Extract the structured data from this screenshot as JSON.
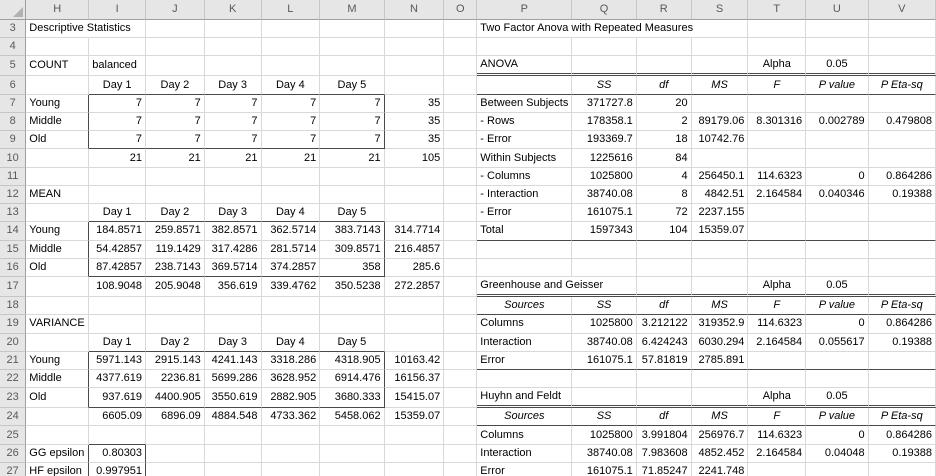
{
  "sheet": {
    "column_headers": [
      "H",
      "I",
      "J",
      "K",
      "L",
      "M",
      "N",
      "O",
      "P",
      "Q",
      "R",
      "S",
      "T",
      "U",
      "V"
    ],
    "row_numbers": [
      3,
      4,
      5,
      6,
      7,
      8,
      9,
      10,
      11,
      12,
      13,
      14,
      15,
      16,
      17,
      18,
      19,
      20,
      21,
      22,
      23,
      24,
      25,
      26,
      27
    ],
    "cells": {
      "H3": "Descriptive Statistics",
      "P3": "Two Factor Anova with Repeated Measures",
      "H5": "COUNT",
      "I5": "balanced",
      "P5": "ANOVA",
      "T5": "Alpha",
      "U5": "0.05",
      "I6": "Day 1",
      "J6": "Day 2",
      "K6": "Day 3",
      "L6": "Day 4",
      "M6": "Day 5",
      "Q6": "SS",
      "R6": "df",
      "S6": "MS",
      "T6": "F",
      "U6": "P value",
      "V6": "P Eta-sq",
      "H7": "Young",
      "I7": "7",
      "J7": "7",
      "K7": "7",
      "L7": "7",
      "M7": "7",
      "N7": "35",
      "P7": "Between Subjects",
      "Q7": "371727.8",
      "R7": "20",
      "H8": "Middle",
      "I8": "7",
      "J8": "7",
      "K8": "7",
      "L8": "7",
      "M8": "7",
      "N8": "35",
      "P8": "- Rows",
      "Q8": "178358.1",
      "R8": "2",
      "S8": "89179.06",
      "T8": "8.301316",
      "U8": "0.002789",
      "V8": "0.479808",
      "H9": "Old",
      "I9": "7",
      "J9": "7",
      "K9": "7",
      "L9": "7",
      "M9": "7",
      "N9": "35",
      "P9": "- Error",
      "Q9": "193369.7",
      "R9": "18",
      "S9": "10742.76",
      "I10": "21",
      "J10": "21",
      "K10": "21",
      "L10": "21",
      "M10": "21",
      "N10": "105",
      "P10": "Within Subjects",
      "Q10": "1225616",
      "R10": "84",
      "P11": "- Columns",
      "Q11": "1025800",
      "R11": "4",
      "S11": "256450.1",
      "T11": "114.6323",
      "U11": "0",
      "V11": "0.864286",
      "H12": "MEAN",
      "P12": "- Interaction",
      "Q12": "38740.08",
      "R12": "8",
      "S12": "4842.51",
      "T12": "2.164584",
      "U12": "0.040346",
      "V12": "0.19388",
      "I13": "Day 1",
      "J13": "Day 2",
      "K13": "Day 3",
      "L13": "Day 4",
      "M13": "Day 5",
      "P13": "- Error",
      "Q13": "161075.1",
      "R13": "72",
      "S13": "2237.155",
      "H14": "Young",
      "I14": "184.8571",
      "J14": "259.8571",
      "K14": "382.8571",
      "L14": "362.5714",
      "M14": "383.7143",
      "N14": "314.7714",
      "P14": "Total",
      "Q14": "1597343",
      "R14": "104",
      "S14": "15359.07",
      "H15": "Middle",
      "I15": "54.42857",
      "J15": "119.1429",
      "K15": "317.4286",
      "L15": "281.5714",
      "M15": "309.8571",
      "N15": "216.4857",
      "H16": "Old",
      "I16": "87.42857",
      "J16": "238.7143",
      "K16": "369.5714",
      "L16": "374.2857",
      "M16": "358",
      "N16": "285.6",
      "I17": "108.9048",
      "J17": "205.9048",
      "K17": "356.619",
      "L17": "339.4762",
      "M17": "350.5238",
      "N17": "272.2857",
      "P17": "Greenhouse and Geisser",
      "T17": "Alpha",
      "U17": "0.05",
      "P18": "Sources",
      "Q18": "SS",
      "R18": "df",
      "S18": "MS",
      "T18": "F",
      "U18": "P value",
      "V18": "P Eta-sq",
      "H19": "VARIANCE",
      "P19": "Columns",
      "Q19": "1025800",
      "R19": "3.212122",
      "S19": "319352.9",
      "T19": "114.6323",
      "U19": "0",
      "V19": "0.864286",
      "I20": "Day 1",
      "J20": "Day 2",
      "K20": "Day 3",
      "L20": "Day 4",
      "M20": "Day 5",
      "P20": "Interaction",
      "Q20": "38740.08",
      "R20": "6.424243",
      "S20": "6030.294",
      "T20": "2.164584",
      "U20": "0.055617",
      "V20": "0.19388",
      "H21": "Young",
      "I21": "5971.143",
      "J21": "2915.143",
      "K21": "4241.143",
      "L21": "3318.286",
      "M21": "4318.905",
      "N21": "10163.42",
      "P21": "Error",
      "Q21": "161075.1",
      "R21": "57.81819",
      "S21": "2785.891",
      "H22": "Middle",
      "I22": "4377.619",
      "J22": "2236.81",
      "K22": "5699.286",
      "L22": "3628.952",
      "M22": "6914.476",
      "N22": "16156.37",
      "H23": "Old",
      "I23": "937.619",
      "J23": "4400.905",
      "K23": "3550.619",
      "L23": "2882.905",
      "M23": "3680.333",
      "N23": "15415.07",
      "P23": "Huyhn and Feldt",
      "T23": "Alpha",
      "U23": "0.05",
      "I24": "6605.09",
      "J24": "6896.09",
      "K24": "4884.548",
      "L24": "4733.362",
      "M24": "5458.062",
      "N24": "15359.07",
      "P24": "Sources",
      "Q24": "SS",
      "R24": "df",
      "S24": "MS",
      "T24": "F",
      "U24": "P value",
      "V24": "P Eta-sq",
      "P25": "Columns",
      "Q25": "1025800",
      "R25": "3.991804",
      "S25": "256976.7",
      "T25": "114.6323",
      "U25": "0",
      "V25": "0.864286",
      "H26": "GG epsilon",
      "I26": "0.80303",
      "P26": "Interaction",
      "Q26": "38740.08",
      "R26": "7.983608",
      "S26": "4852.452",
      "T26": "2.164584",
      "U26": "0.04048",
      "V26": "0.19388",
      "H27": "HF epsilon",
      "I27": "0.997951",
      "P27": "Error",
      "Q27": "161075.1",
      "R27": "71.85247",
      "S27": "2241.748"
    }
  },
  "colors": {
    "gridline": "#d9d9d9",
    "dark_border": "#4a4a4a",
    "header_background": "#e6e6e6",
    "header_text": "#595959",
    "cell_text": "#000000"
  }
}
